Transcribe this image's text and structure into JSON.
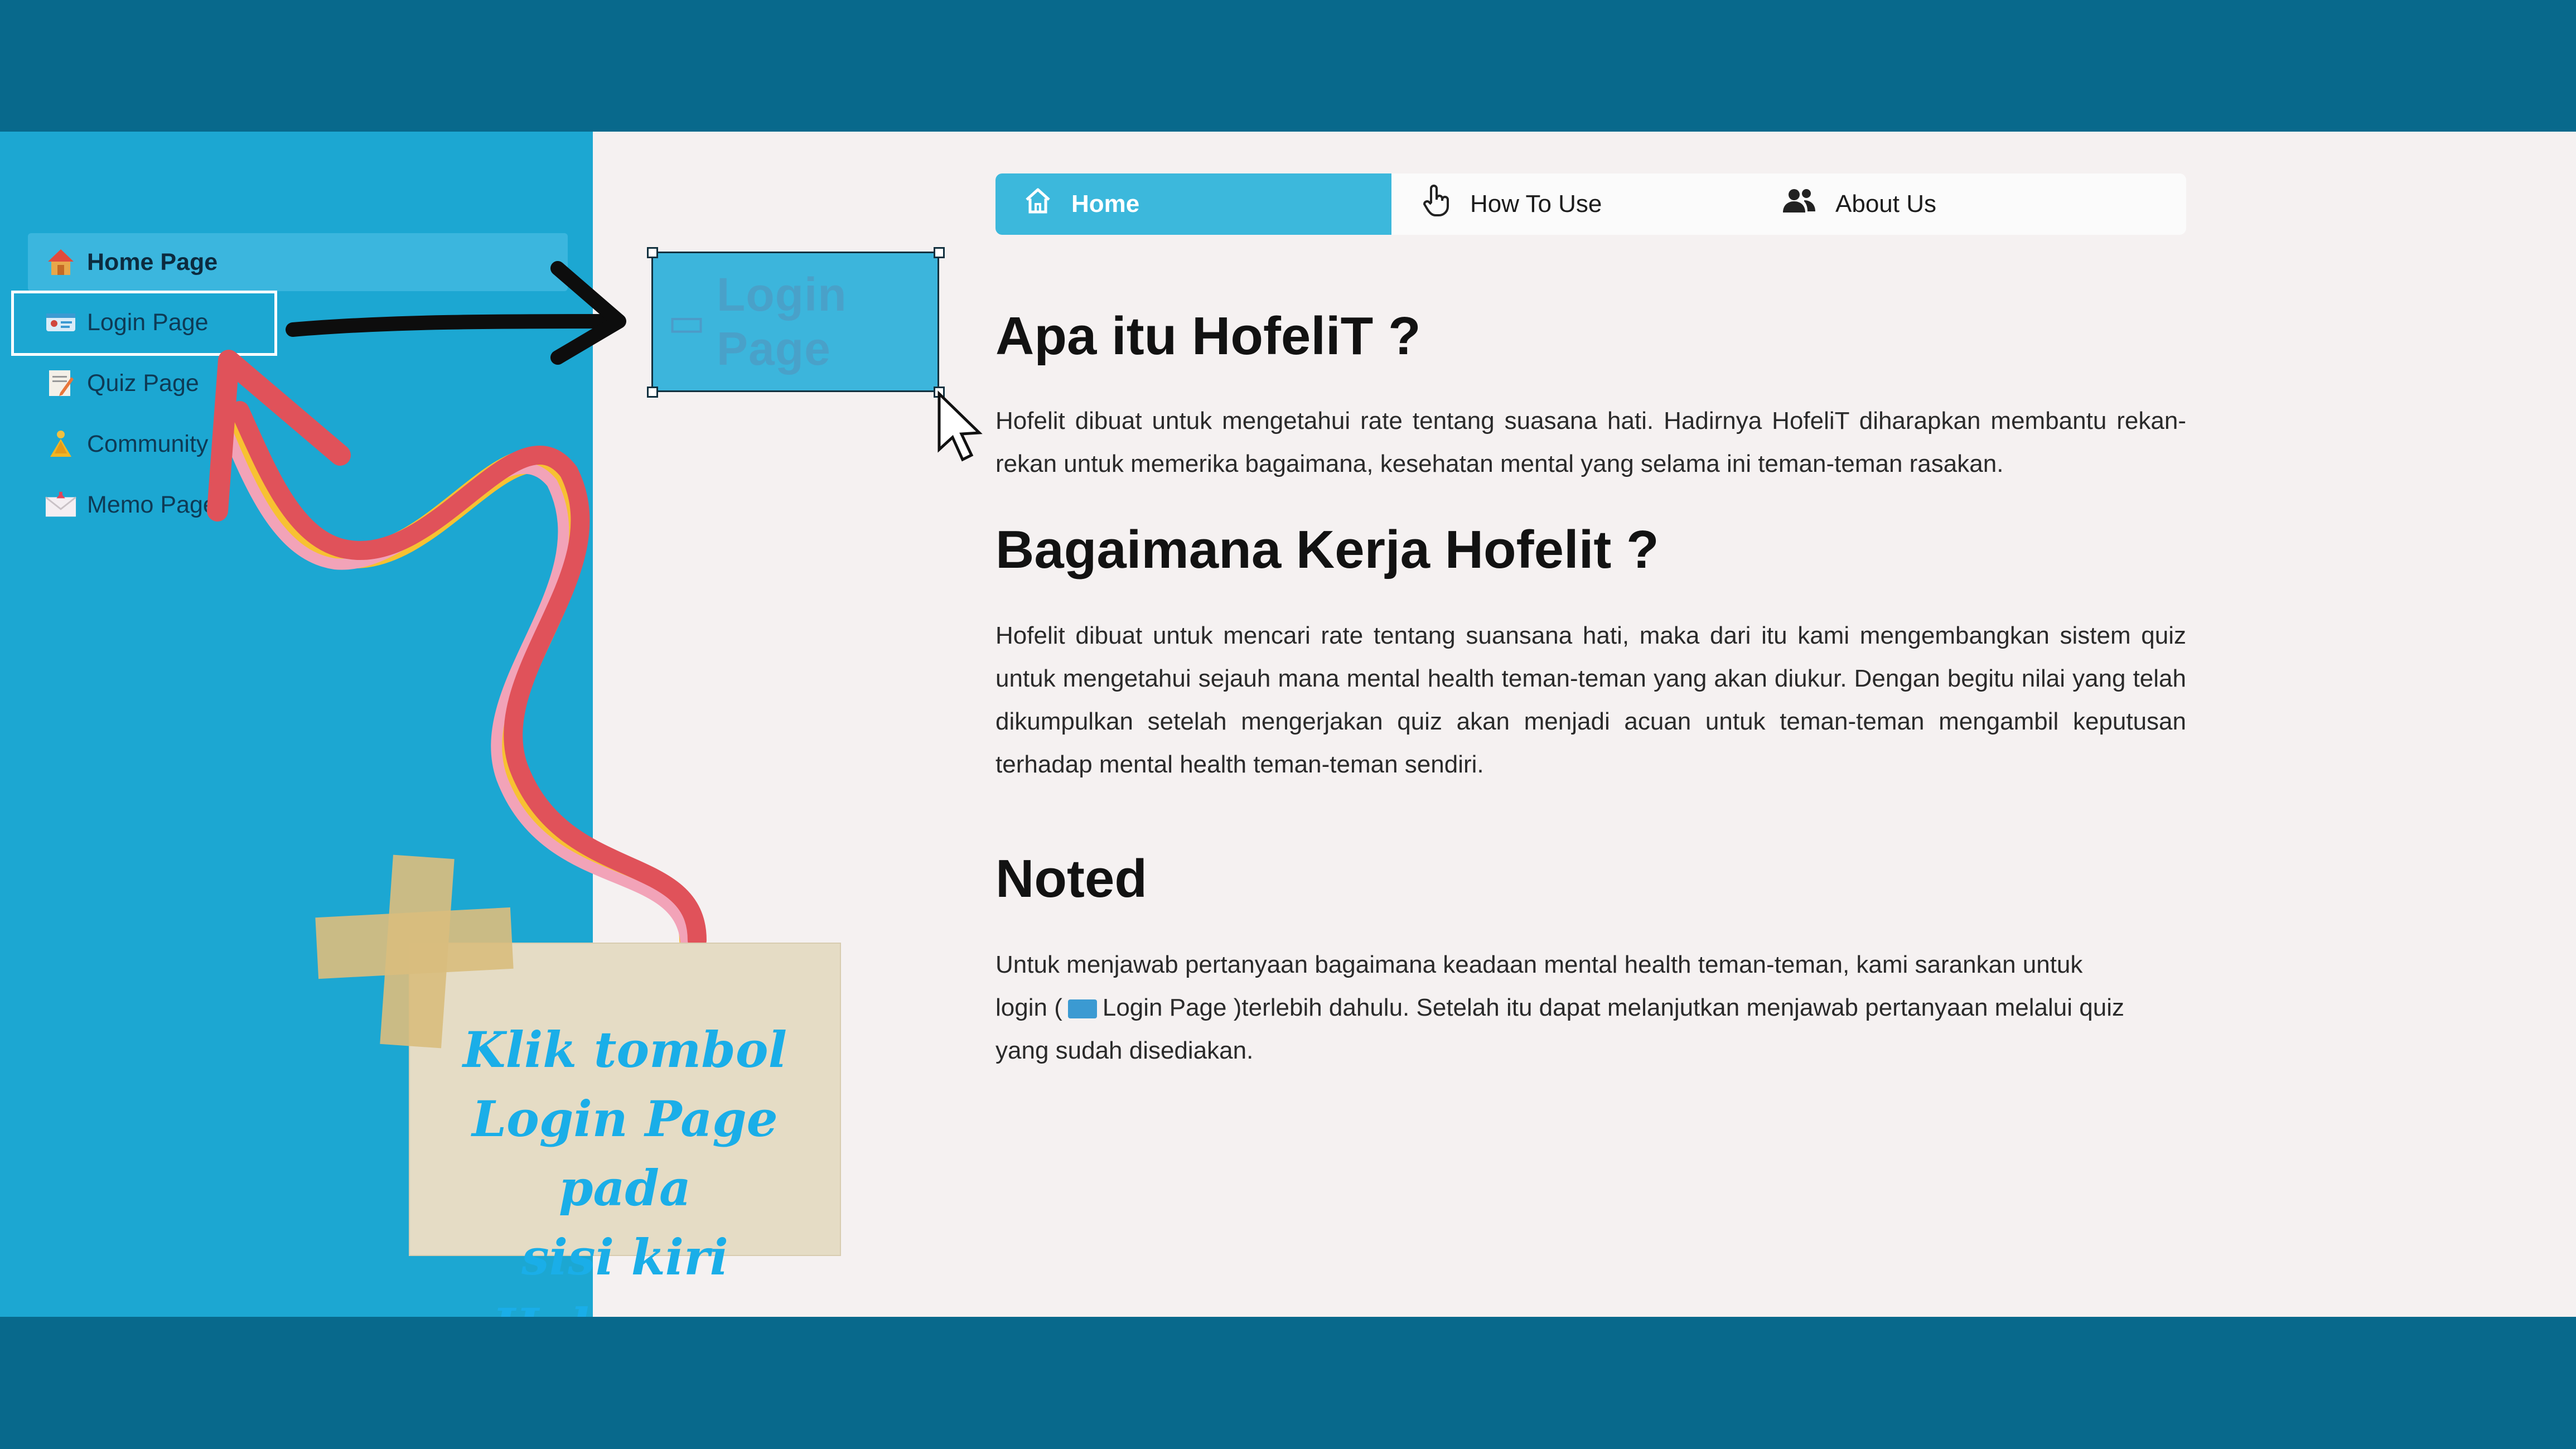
{
  "sidebar": {
    "items": [
      {
        "label": "Home Page",
        "icon": "home-icon"
      },
      {
        "label": "Login Page",
        "icon": "id-card-icon"
      },
      {
        "label": "Quiz Page",
        "icon": "quiz-icon"
      },
      {
        "label": "Community",
        "icon": "community-icon"
      },
      {
        "label": "Memo Page",
        "icon": "mail-icon"
      }
    ]
  },
  "zoom_callout": {
    "label": "Login Page"
  },
  "nav": {
    "tabs": [
      {
        "label": "Home",
        "icon": "home-outline-icon"
      },
      {
        "label": "How To Use",
        "icon": "pointer-hand-icon"
      },
      {
        "label": "About Us",
        "icon": "users-icon"
      }
    ]
  },
  "content": {
    "section1_title": "Apa itu HofeliT ?",
    "section1_text": "Hofelit dibuat untuk mengetahui rate tentang suasana hati. Hadirnya HofeliT diharapkan membantu rekan-rekan untuk memerika bagaimana, kesehatan mental yang selama ini teman-teman rasakan.",
    "section2_title": "Bagaimana Kerja Hofelit ?",
    "section2_text": "Hofelit dibuat untuk mencari rate tentang suansana hati, maka dari itu kami mengembangkan sistem quiz untuk mengetahui sejauh mana mental health teman-teman yang akan diukur. Dengan begitu nilai yang telah dikumpulkan setelah mengerjakan quiz akan menjadi acuan untuk teman-teman mengambil keputusan terhadap mental health teman-teman sendiri.",
    "section3_title": "Noted",
    "section3_line1": "Untuk menjawab pertanyaan bagaimana keadaan mental health teman-teman, kami sarankan untuk",
    "section3_line2_pre": "login (",
    "section3_line2_link": "Login Page",
    "section3_line2_post": ")terlebih dahulu. Setelah itu dapat melanjutkan menjawab pertanyaan melalui quiz",
    "section3_line3": "yang sudah disediakan."
  },
  "annotation": {
    "line1": "Klik tombol",
    "line2": "Login Page pada",
    "line3": "sisi kiri Halaman."
  },
  "colors": {
    "band": "#08698c",
    "sidebar": "#1ca7d2",
    "accent": "#3cb8dc",
    "annotation_text": "#1aaee8",
    "ribbon_red": "#e0525a",
    "ribbon_yellow": "#f7c132",
    "ribbon_pink": "#f2a3b8"
  }
}
